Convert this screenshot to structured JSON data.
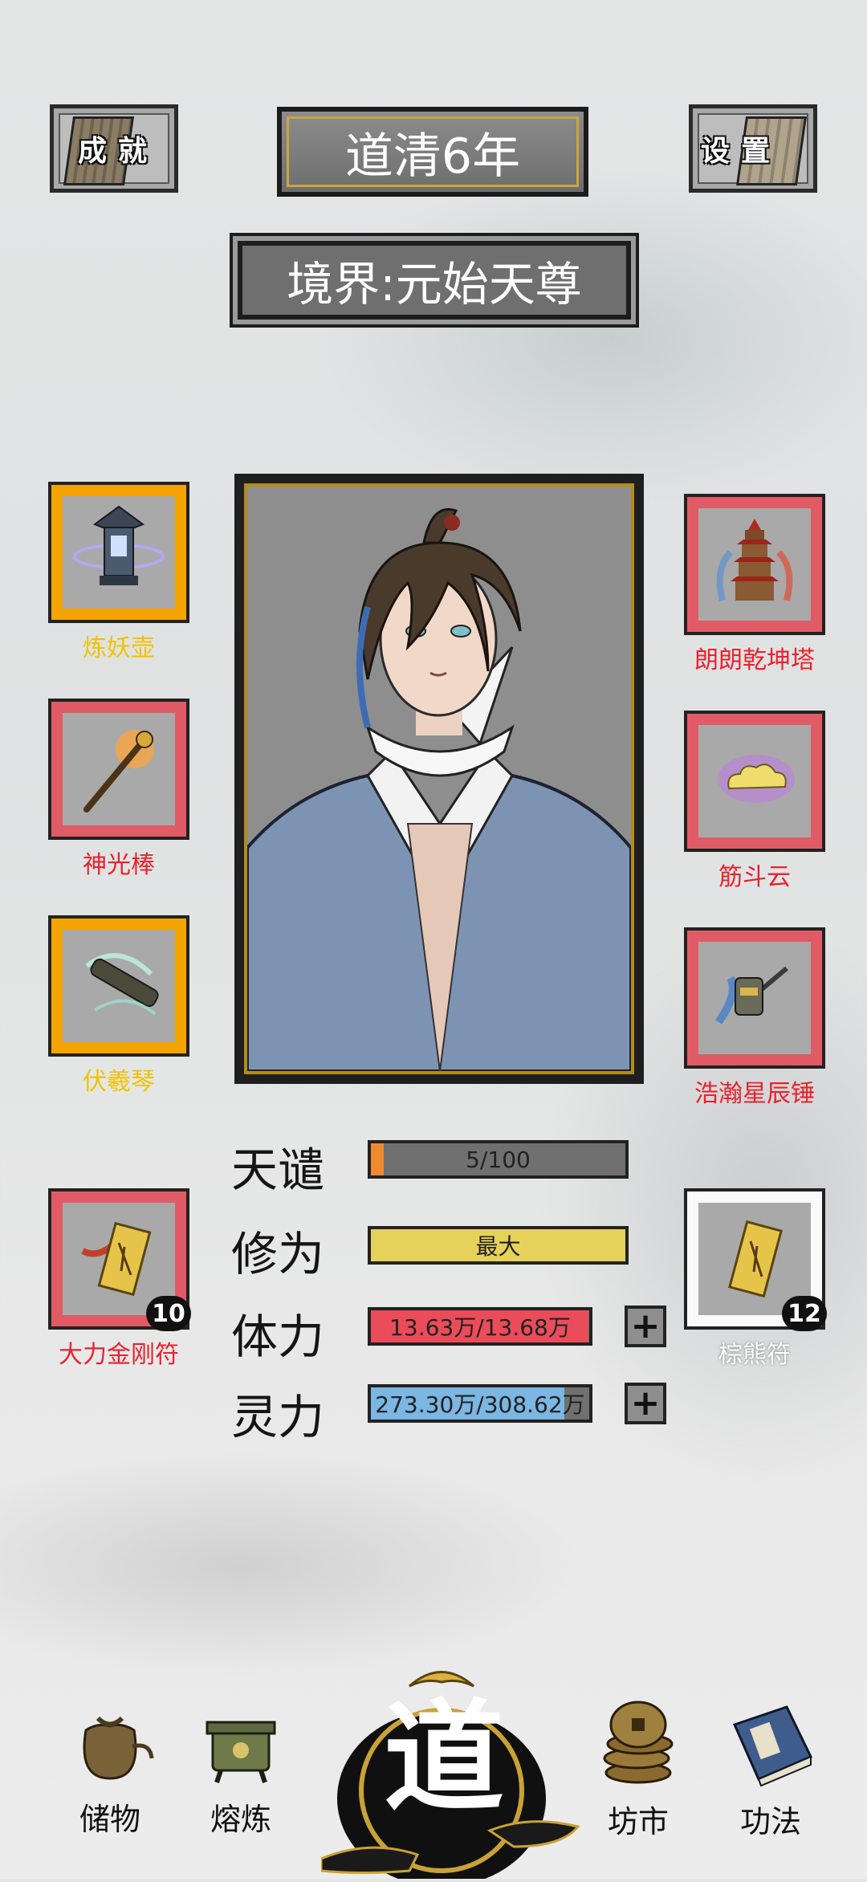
{
  "header": {
    "achievement_label": "成就",
    "settings_label": "设置",
    "year": "道清6年",
    "realm": "境界:元始天尊"
  },
  "left_items": [
    {
      "name": "炼妖壶",
      "rarity": "gold"
    },
    {
      "name": "神光棒",
      "rarity": "red"
    },
    {
      "name": "伏羲琴",
      "rarity": "gold"
    }
  ],
  "right_items": [
    {
      "name": "朗朗乾坤塔",
      "rarity": "red"
    },
    {
      "name": "筋斗云",
      "rarity": "red"
    },
    {
      "name": "浩瀚星辰锤",
      "rarity": "red"
    }
  ],
  "talismans": {
    "left": {
      "name": "大力金刚符",
      "count": "10",
      "rarity": "red"
    },
    "right": {
      "name": "棕熊符",
      "count": "12",
      "rarity": "white"
    }
  },
  "stats": {
    "tianqian": {
      "label": "天谴",
      "value": "5/100",
      "fraction": 0.05,
      "color": "#f08a2e"
    },
    "xiuwei": {
      "label": "修为",
      "value": "最大",
      "fraction": 1.0,
      "color": "#e6d25a"
    },
    "tili": {
      "label": "体力",
      "value": "13.63万/13.68万",
      "fraction": 0.996,
      "color": "#ea4c5a"
    },
    "lingli": {
      "label": "灵力",
      "value": "273.30万/308.62万",
      "fraction": 0.886,
      "color": "#7cb6e2"
    }
  },
  "plus": "+",
  "nav": {
    "storage": "储物",
    "smelt": "熔炼",
    "center": "道",
    "market": "坊市",
    "skills": "功法"
  }
}
